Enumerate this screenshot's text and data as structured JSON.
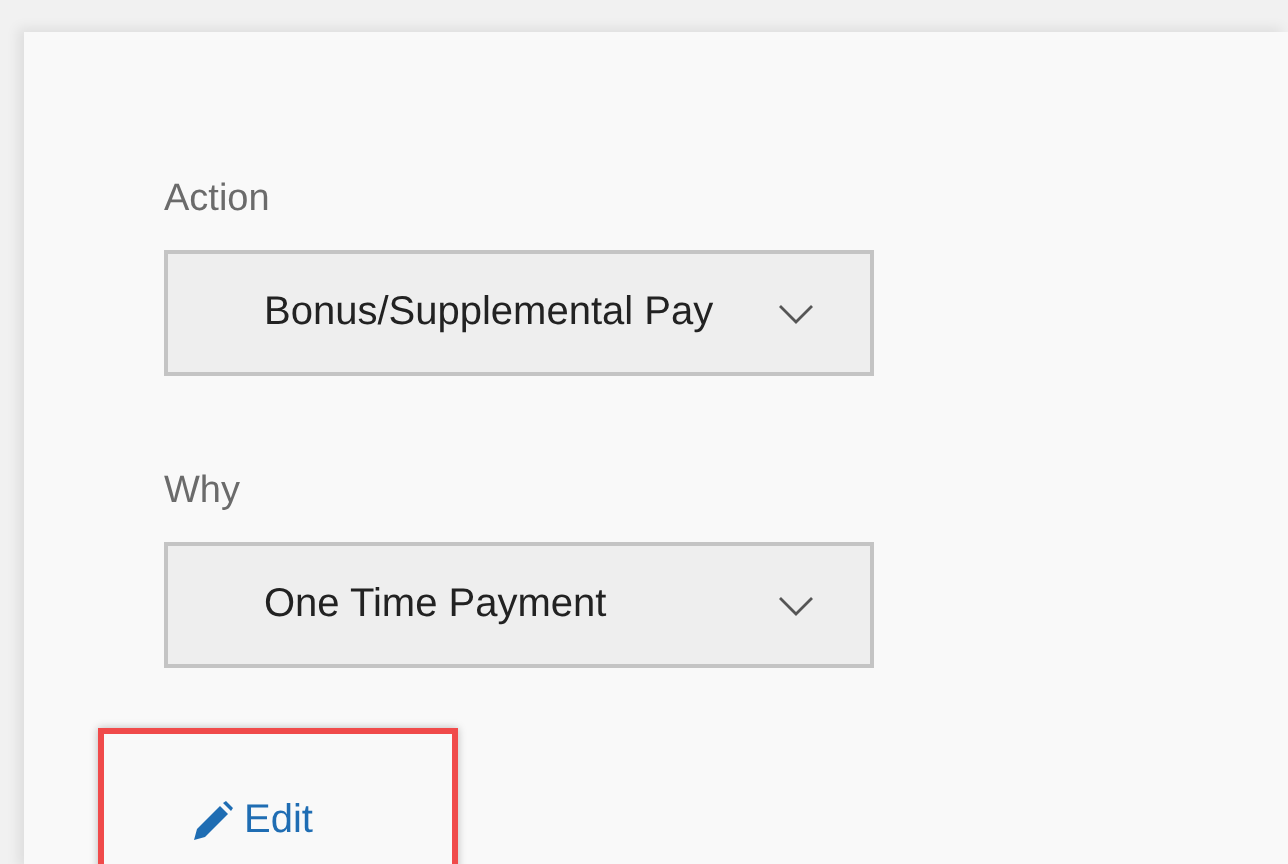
{
  "fields": [
    {
      "label": "Action",
      "value": "Bonus/Supplemental Pay"
    },
    {
      "label": "Why",
      "value": "One Time Payment"
    }
  ],
  "edit_link": {
    "label": "Edit",
    "highlighted": true
  }
}
